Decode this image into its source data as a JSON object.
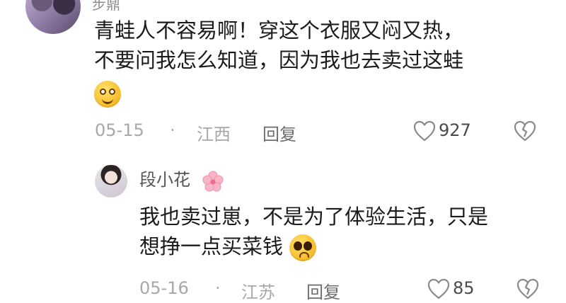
{
  "top_comment": {
    "username_fragment": "步鼎",
    "text_line1": "青蛙人不容易啊！穿这个衣服又闷又热，",
    "text_line2": "不要问我怎么知道，因为我也去卖过这蛙",
    "emoji": "smiling-face-emoji",
    "date": "05-15",
    "separator": "·",
    "location": "江西",
    "reply_label": "回复",
    "like_count": "927"
  },
  "reply_comment": {
    "username": "段小花",
    "name_icon": "cherry-blossom-icon",
    "text_line1": "我也卖过崽，不是为了体验生活，只是",
    "text_line2": "想挣一点买菜钱",
    "emoji": "pleading-face-emoji",
    "date": "05-16",
    "separator": "·",
    "location": "江苏",
    "reply_label": "回复",
    "like_count": "85"
  },
  "colors": {
    "meta_gray": "#a8a8a8",
    "text": "#1b1b1b",
    "username_gray": "#555555"
  }
}
